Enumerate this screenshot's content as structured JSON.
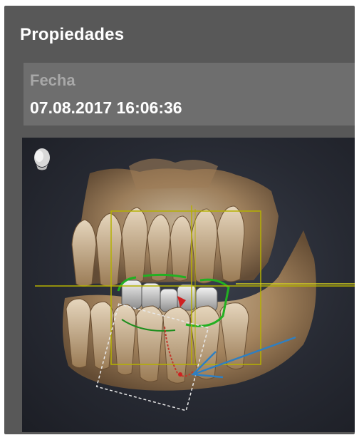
{
  "panel": {
    "title": "Propiedades"
  },
  "properties": [
    {
      "label": "Fecha",
      "value": "07.08.2017 16:06:36"
    }
  ],
  "viewer": {
    "orientation_icon": "head-orientation-icon",
    "content": "3d-dental-volume-render"
  },
  "colors": {
    "panel_background": "#585858",
    "property_background": "#6e6e6e",
    "label_text": "#a8a8a8",
    "value_text": "#ffffff",
    "viewer_background": "#272a33",
    "crosshair_yellow": "#b5b100",
    "nerve_canal_red": "#c0392b",
    "direction_arrow_blue": "#2f7fc1",
    "bite_line_green": "#22b022"
  }
}
